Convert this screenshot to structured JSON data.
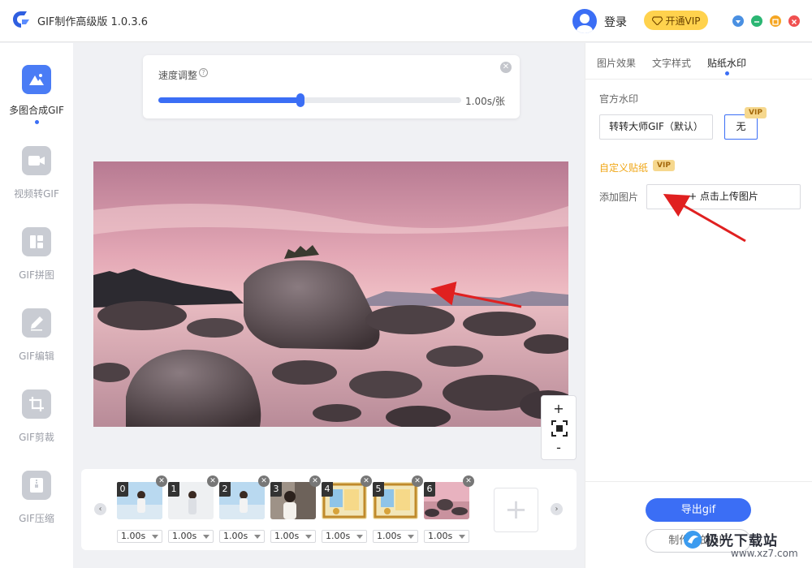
{
  "app": {
    "title": "GIF制作高级版 1.0.3.6"
  },
  "header": {
    "login_label": "登录",
    "vip_label": "开通VIP"
  },
  "colors": {
    "accent": "#3b6ef5",
    "vip_gold": "#ffd24d",
    "min_btn": "#2bb673",
    "max_btn": "#f5a623",
    "close_btn": "#f05050",
    "menu_btn": "#4a90e2",
    "annotation_arrow": "#e02020"
  },
  "sidebar": {
    "items": [
      {
        "label": "多图合成GIF",
        "icon": "mountain-image-icon",
        "active": true
      },
      {
        "label": "视频转GIF",
        "icon": "video-icon",
        "active": false
      },
      {
        "label": "GIF拼图",
        "icon": "collage-icon",
        "active": false
      },
      {
        "label": "GIF编辑",
        "icon": "pencil-icon",
        "active": false
      },
      {
        "label": "GIF剪裁",
        "icon": "crop-icon",
        "active": false
      },
      {
        "label": "GIF压缩",
        "icon": "compress-icon",
        "active": false
      }
    ]
  },
  "speed": {
    "label": "速度调整",
    "help": "?",
    "value_label": "1.00s/张",
    "slider_fraction": 0.47
  },
  "zoom": {
    "in": "+",
    "out": "-"
  },
  "filmstrip": {
    "frames": [
      {
        "index": "0",
        "duration": "1.00s",
        "thumb": "portrait-sky"
      },
      {
        "index": "1",
        "duration": "1.00s",
        "thumb": "portrait-white"
      },
      {
        "index": "2",
        "duration": "1.00s",
        "thumb": "portrait-sky"
      },
      {
        "index": "3",
        "duration": "1.00s",
        "thumb": "portrait-indoor"
      },
      {
        "index": "4",
        "duration": "1.00s",
        "thumb": "framed-card"
      },
      {
        "index": "5",
        "duration": "1.00s",
        "thumb": "framed-card"
      },
      {
        "index": "6",
        "duration": "1.00s",
        "thumb": "lake-sunset"
      }
    ],
    "add_label": "+"
  },
  "right_panel": {
    "tabs": [
      "图片效果",
      "文字样式",
      "贴纸水印"
    ],
    "active_tab": "贴纸水印",
    "official_watermark_label": "官方水印",
    "watermark_options": [
      "转转大师GIF（默认）",
      "无"
    ],
    "vip_tag": "VIP",
    "custom_sticker_label": "自定义贴纸",
    "add_image_label": "添加图片",
    "upload_button": "+ 点击上传图片",
    "export_button": "导出gif",
    "new_button": "制作新的GIF"
  },
  "watermark_site": {
    "name": "极光下载站",
    "url": "www.xz7.com"
  }
}
